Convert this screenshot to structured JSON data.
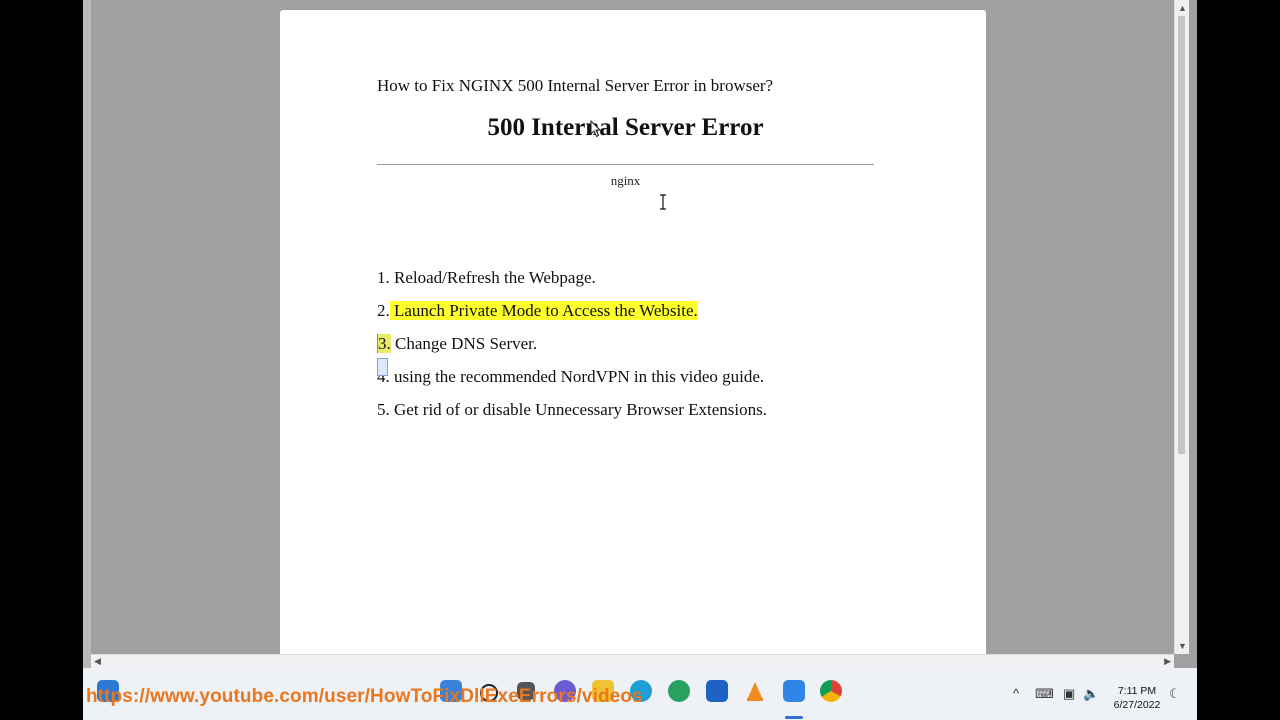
{
  "document": {
    "title": "How to Fix NGINX 500 Internal Server Error in browser?",
    "error_heading": "500 Internal Server Error",
    "error_server": "nginx",
    "steps": [
      {
        "num": "1.",
        "text": "Reload/Refresh the Webpage."
      },
      {
        "num": "2.",
        "text": "Launch Private Mode to Access the Website."
      },
      {
        "num": "3.",
        "text": "Change DNS Server."
      },
      {
        "num": "4.",
        "text": "using the recommended NordVPN in this video guide."
      },
      {
        "num": "5.",
        "text": "Get rid of or disable Unnecessary Browser Extensions."
      }
    ],
    "highlight_color": "#ffff2e"
  },
  "overlay": {
    "url": "https://www.youtube.com/user/HowToFixDllExeErrors/videos"
  },
  "taskbar": {
    "icons": [
      "windows-start-icon",
      "search-icon",
      "task-view-icon",
      "teams-chat-icon",
      "file-explorer-icon",
      "edge-icon",
      "edge-icon-2",
      "microsoft-store-icon",
      "vlc-icon",
      "app-active-icon",
      "chrome-icon"
    ],
    "tray": {
      "chevron": "^",
      "time": "7:11 PM",
      "date": "6/27/2022"
    }
  }
}
